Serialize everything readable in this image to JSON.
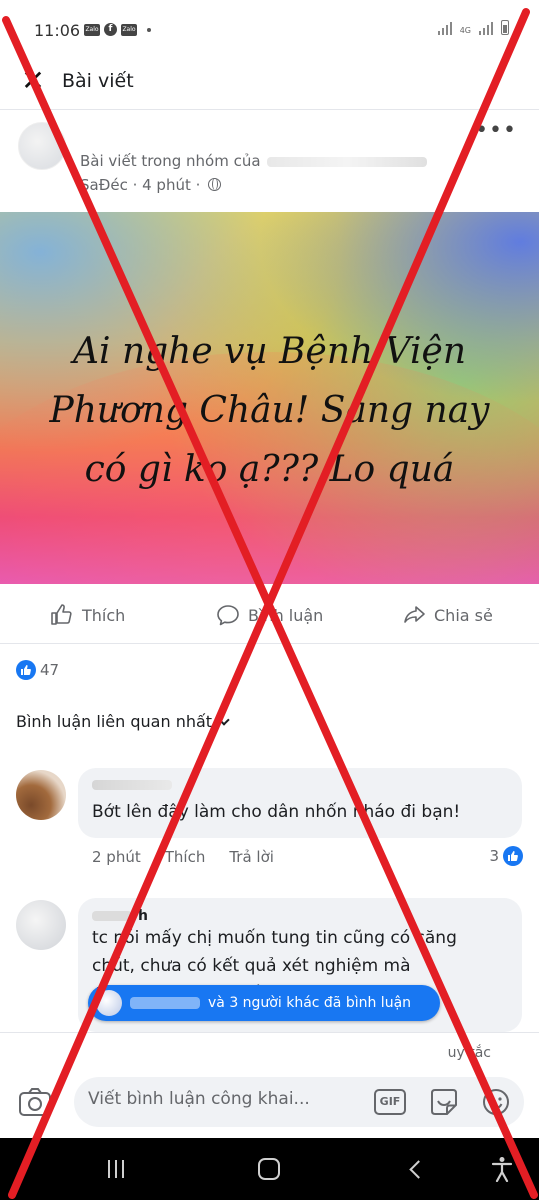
{
  "status_bar": {
    "time": "11:06",
    "app_icons": [
      "Zalo",
      "f",
      "Zalo"
    ],
    "network": "4G"
  },
  "header": {
    "title": "Bài viết"
  },
  "post": {
    "group_prefix": "Bài viết trong nhóm của",
    "location_time": "SaĐéc · 4 phút ·",
    "text": "Ai nghe vụ Bệnh Viện\nPhương Châu! Sáng nay\ncó gì ko ạ??? Lo quá",
    "gradient_colors": [
      "#f6d84c",
      "#f27a55",
      "#ee4a79",
      "#5a78e6"
    ]
  },
  "actions": {
    "like": "Thích",
    "comment": "Bình luận",
    "share": "Chia sẻ"
  },
  "reactions": {
    "count": "47",
    "accent": "#1877f2"
  },
  "comments_sort": "Bình luận liên quan nhất",
  "comments": [
    {
      "text": "Bớt lên đây làm cho dân nhốn nháo đi bạn!",
      "time": "2 phút",
      "like": "Thích",
      "reply": "Trả lời",
      "reactions": "3"
    },
    {
      "name_partial": "h",
      "text": "tc nói mấy chị muốn tung tin cũng có căng\nchút, chưa có kết quả xét nghiệm mà\nđừng vội, nên có kết quả với lên thì ..."
    }
  ],
  "others_commented": "và 3 người khác đã bình luận",
  "composer": {
    "rules": "uy tắc",
    "placeholder": "Viết bình luận công khai...",
    "gif": "GIF"
  },
  "overlay": {
    "cross_color": "#e31e24"
  }
}
